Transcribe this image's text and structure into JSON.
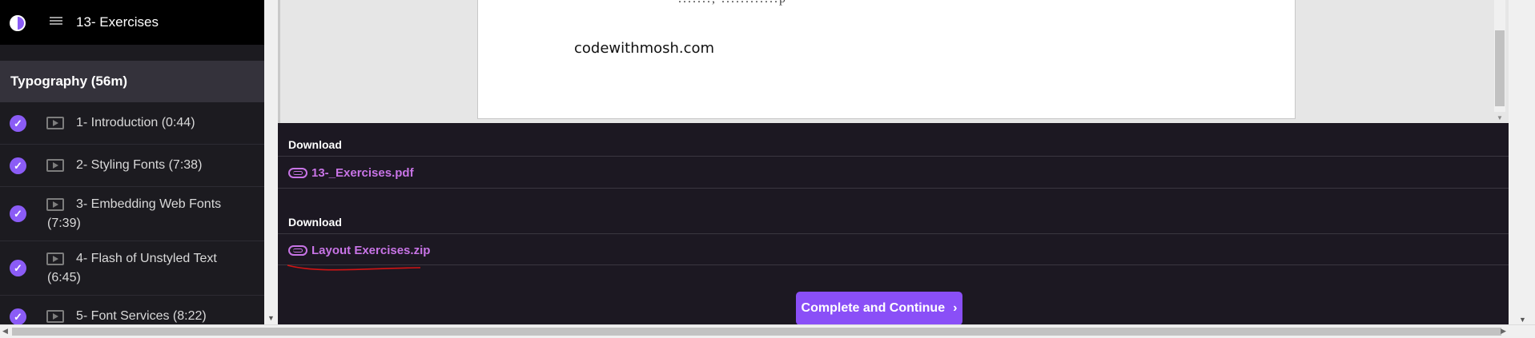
{
  "sidebar": {
    "current_lesson": {
      "label": "13- Exercises"
    },
    "section": {
      "title": "Typography (56m)"
    },
    "lessons": [
      {
        "title": "1- Introduction (0:44)"
      },
      {
        "title": "2- Styling Fonts (7:38)"
      },
      {
        "title": "3- Embedding Web Fonts (7:39)"
      },
      {
        "title": "4- Flash of Unstyled Text (6:45)"
      },
      {
        "title": "5- Font Services (8:22)"
      }
    ]
  },
  "viewer": {
    "cut_text": "......., ............p",
    "site": "codewithmosh.com"
  },
  "downloads": [
    {
      "heading": "Download",
      "file": "13-_Exercises.pdf"
    },
    {
      "heading": "Download",
      "file": "Layout Exercises.zip"
    }
  ],
  "cta": {
    "label": "Complete and Continue",
    "chevron": "›"
  },
  "colors": {
    "accent": "#8a4ff7",
    "link": "#c874e6",
    "annotation": "#d21414"
  }
}
